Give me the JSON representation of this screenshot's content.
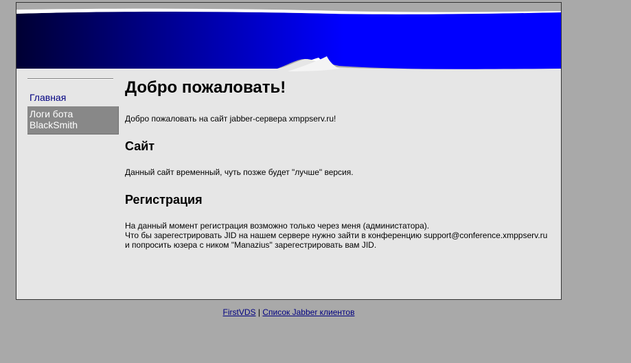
{
  "banner": {
    "colors": {
      "dark": "#000033",
      "mid": "#0000aa",
      "bright": "#0000ff",
      "swoosh": "#ffffff"
    }
  },
  "sidebar": {
    "items": [
      {
        "label": "Главная",
        "active": false
      },
      {
        "label": "Логи бота BlackSmith",
        "active": true
      }
    ]
  },
  "main": {
    "title": "Добро пожаловать!",
    "intro": "Добро пожаловать на сайт jabber-сервера xmppserv.ru!",
    "sections": [
      {
        "heading": "Сайт",
        "lines": [
          "Данный сайт временный, чуть позже будет \"лучше\" версия."
        ]
      },
      {
        "heading": "Регистрация",
        "lines": [
          "На данный момент регистрация возможно только через меня (администатора).",
          "Что бы зарегестрировать JID на нашем сервере нужно зайти в конференцию support@conference.xmppserv.ru",
          "и попросить юзера с ником \"Manazius\" зарегестрировать вам JID."
        ]
      }
    ]
  },
  "footer": {
    "link1": "FirstVDS",
    "separator": "|",
    "link2": "Список Jabber клиентов"
  }
}
